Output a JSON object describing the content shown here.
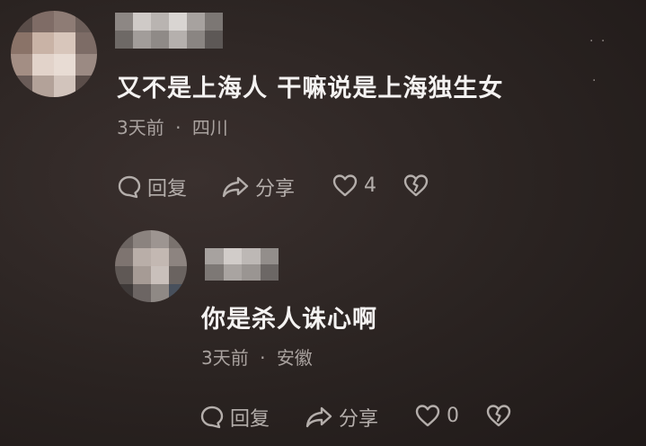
{
  "comments": [
    {
      "text": "又不是上海人 干嘛说是上海独生女",
      "time": "3天前",
      "separator": "·",
      "location": "四川",
      "reply_label": "回复",
      "share_label": "分享",
      "like_count": "4"
    }
  ],
  "replies": [
    {
      "text": "你是杀人诛心啊",
      "time": "3天前",
      "separator": "·",
      "location": "安徽",
      "reply_label": "回复",
      "share_label": "分享",
      "like_count": "0"
    }
  ],
  "icons": {
    "reply": "comment-bubble-icon",
    "share": "share-arrow-icon",
    "like": "heart-icon",
    "dislike": "broken-heart-icon",
    "more": "more-dots-icon"
  },
  "colors": {
    "background": "#28201f",
    "text": "#f4f2f1",
    "meta": "#a9a29f"
  }
}
